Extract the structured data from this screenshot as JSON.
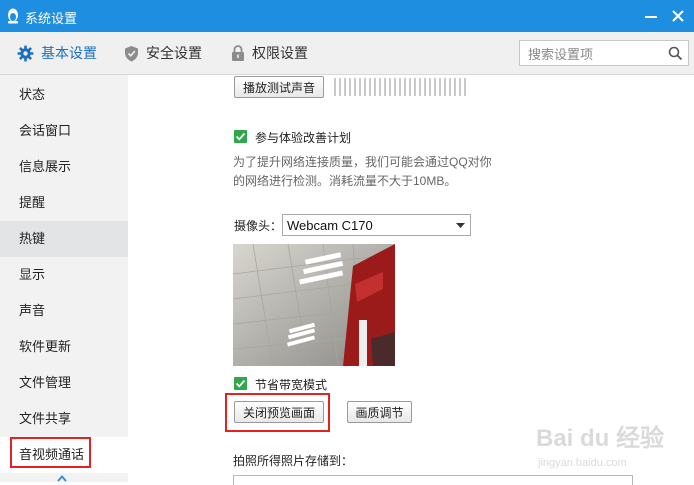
{
  "window": {
    "title": "系统设置",
    "minimize_icon": "minimize-icon",
    "close_icon": "close-icon"
  },
  "tabs": [
    {
      "label": "基本设置",
      "icon": "gear-icon",
      "active": true
    },
    {
      "label": "安全设置",
      "icon": "shield-icon",
      "active": false
    },
    {
      "label": "权限设置",
      "icon": "lock-icon",
      "active": false
    }
  ],
  "search": {
    "placeholder": "搜索设置项",
    "icon": "search-icon"
  },
  "sidebar": {
    "items": [
      {
        "label": "状态"
      },
      {
        "label": "会话窗口"
      },
      {
        "label": "信息展示"
      },
      {
        "label": "提醒"
      },
      {
        "label": "热键"
      },
      {
        "label": "显示"
      },
      {
        "label": "声音"
      },
      {
        "label": "软件更新"
      },
      {
        "label": "文件管理"
      },
      {
        "label": "文件共享"
      },
      {
        "label": "音视频通话"
      }
    ],
    "hovered": "热键",
    "selected": "音视频通话"
  },
  "audio": {
    "test_sound_button": "播放测试声音"
  },
  "experience": {
    "checkbox_label": "参与体验改善计划",
    "checked": true,
    "description": "为了提升网络连接质量，我们可能会通过QQ对你的网络进行检测。消耗流量不大于10MB。"
  },
  "camera": {
    "label": "摄像头：",
    "selected_device": "Webcam C170",
    "bandwidth_checkbox_label": "节省带宽模式",
    "bandwidth_checked": true,
    "close_preview_button": "关闭预览画面",
    "quality_button": "画质调节"
  },
  "photo": {
    "save_path_label": "拍照所得照片存储到："
  },
  "watermark": {
    "brand": "Bai du 经验",
    "url": "jingyan.baidu.com"
  },
  "colors": {
    "titlebar": "#1d8ee0",
    "active_tab": "#1d6fbf",
    "checkbox": "#2ea84a",
    "highlight_box": "#e52222"
  }
}
